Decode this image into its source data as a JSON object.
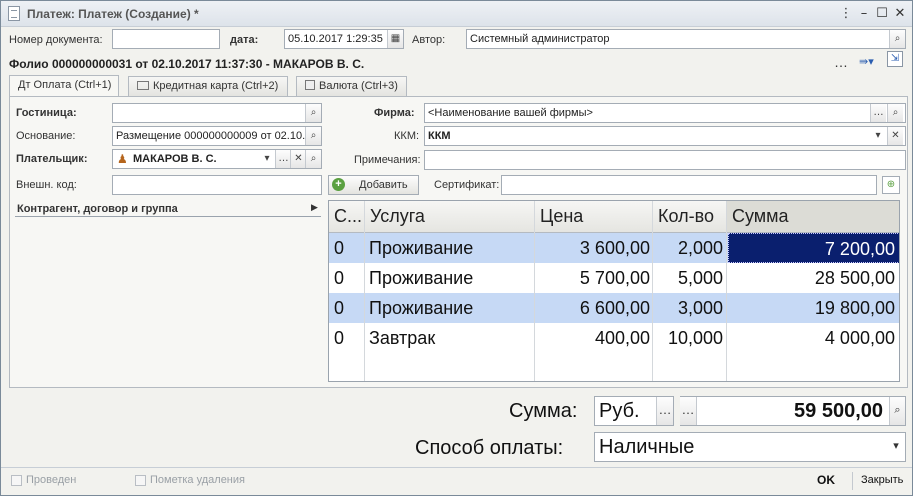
{
  "window": {
    "title": "Платеж: Платеж (Создание) *"
  },
  "header": {
    "doc_number_label": "Номер документа:",
    "doc_number_value": "",
    "date_label": "дата:",
    "date_value": "05.10.2017  1:29:35",
    "author_label": "Автор:",
    "author_value": "Системный администратор",
    "folio": "Фолио 000000000031 от 02.10.2017 11:37:30 - МАКАРОВ В. С."
  },
  "tabs": [
    {
      "label": "Дт Оплата (Ctrl+1)"
    },
    {
      "label": "Кредитная карта (Ctrl+2)"
    },
    {
      "label": "Валюта (Ctrl+3)"
    }
  ],
  "form": {
    "hotel_label": "Гостиница:",
    "hotel_value": "",
    "basis_label": "Основание:",
    "basis_value": "Размещение 000000000009 от 02.10.",
    "payer_label": "Плательщик:",
    "payer_value": "МАКАРОВ В. С.",
    "ext_code_label": "Внешн. код:",
    "ext_code_value": "",
    "firm_label": "Фирма:",
    "firm_value": "<Наименование вашей фирмы>",
    "kkm_label": "ККМ:",
    "kkm_value": "ККМ",
    "notes_label": "Примечания:",
    "notes_value": "",
    "add_button": "Добавить",
    "certificate_label": "Сертификат:",
    "certificate_value": "",
    "counterparty_section": "Контрагент, договор и группа"
  },
  "table": {
    "columns": [
      "С...",
      "Услуга",
      "Цена",
      "Кол-во",
      "Сумма"
    ],
    "rows": [
      {
        "c": "0",
        "service": "Проживание",
        "price": "3 600,00",
        "qty": "2,000",
        "sum": "7 200,00"
      },
      {
        "c": "0",
        "service": "Проживание",
        "price": "5 700,00",
        "qty": "5,000",
        "sum": "28 500,00"
      },
      {
        "c": "0",
        "service": "Проживание",
        "price": "6 600,00",
        "qty": "3,000",
        "sum": "19 800,00"
      },
      {
        "c": "0",
        "service": "Завтрак",
        "price": "400,00",
        "qty": "10,000",
        "sum": "4 000,00"
      }
    ]
  },
  "totals": {
    "sum_label": "Сумма:",
    "currency": "Руб.",
    "sum_value": "59 500,00",
    "payment_method_label": "Способ оплаты:",
    "payment_method_value": "Наличные"
  },
  "footer": {
    "posted_label": "Проведен",
    "deletion_mark_label": "Пометка удаления",
    "ok_label": "OK",
    "close_label": "Закрыть"
  },
  "colors": {
    "selected_row": "#c6d9f5",
    "active_cell_bg": "#0a1f6e",
    "title_bg": "#e3e8ee"
  }
}
